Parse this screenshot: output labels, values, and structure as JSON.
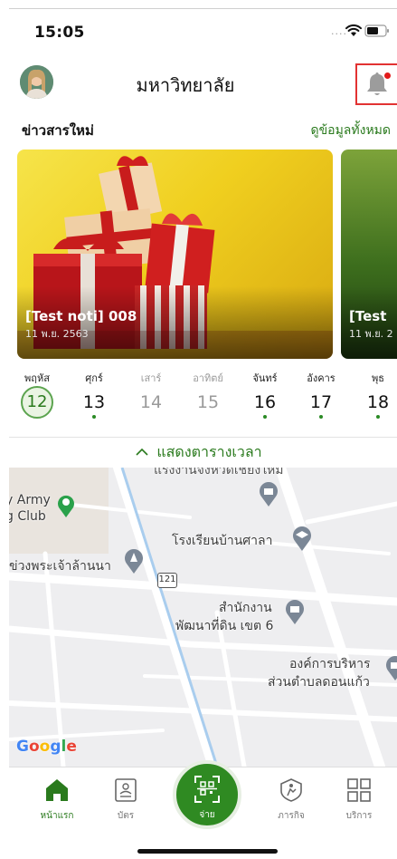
{
  "status": {
    "time": "15:05",
    "dots": "...."
  },
  "header": {
    "title": "มหาวิทยาลัย"
  },
  "news": {
    "heading": "ข่าวสารใหม่",
    "see_all": "ดูข้อมูลทั้งหมด",
    "cards": [
      {
        "title": "[Test noti] 008",
        "date": "11 พ.ย. 2563"
      },
      {
        "title": "[Test",
        "date": "11 พ.ย. 2"
      }
    ]
  },
  "week": {
    "days": [
      {
        "name": "พฤหัส",
        "date": "12",
        "state": "today"
      },
      {
        "name": "ศุกร์",
        "date": "13",
        "state": "event"
      },
      {
        "name": "เสาร์",
        "date": "14",
        "state": "muted"
      },
      {
        "name": "อาทิตย์",
        "date": "15",
        "state": "muted"
      },
      {
        "name": "จันทร์",
        "date": "16",
        "state": "event"
      },
      {
        "name": "อังคาร",
        "date": "17",
        "state": "event"
      },
      {
        "name": "พุธ",
        "date": "18",
        "state": "event"
      }
    ],
    "show_timetable": "แสดงตารางเวลา"
  },
  "map": {
    "labels": {
      "army_1": "y Army",
      "army_2": "g Club",
      "school": "โรงเรียนบ้านศาลา",
      "temple": "ข่วงพระเจ้าล้านนา",
      "route": "121",
      "office_1": "สำนักงาน",
      "office_2": "พัฒนาที่ดิน เขต 6",
      "org_1": "องค์การบริหาร",
      "org_2": "ส่วนตำบลดอนแก้ว",
      "top_cut": "แรงงานจังหวัดเชียงใหม่"
    },
    "attribution": "Google"
  },
  "nav": {
    "home": "หน้าแรก",
    "card": "บัตร",
    "pay": "จ่าย",
    "activity": "ภารกิจ",
    "services": "บริการ"
  },
  "colors": {
    "brand_green": "#2a7a1d",
    "pay_green": "#2f8a22",
    "alert_red": "#e21b1b"
  }
}
